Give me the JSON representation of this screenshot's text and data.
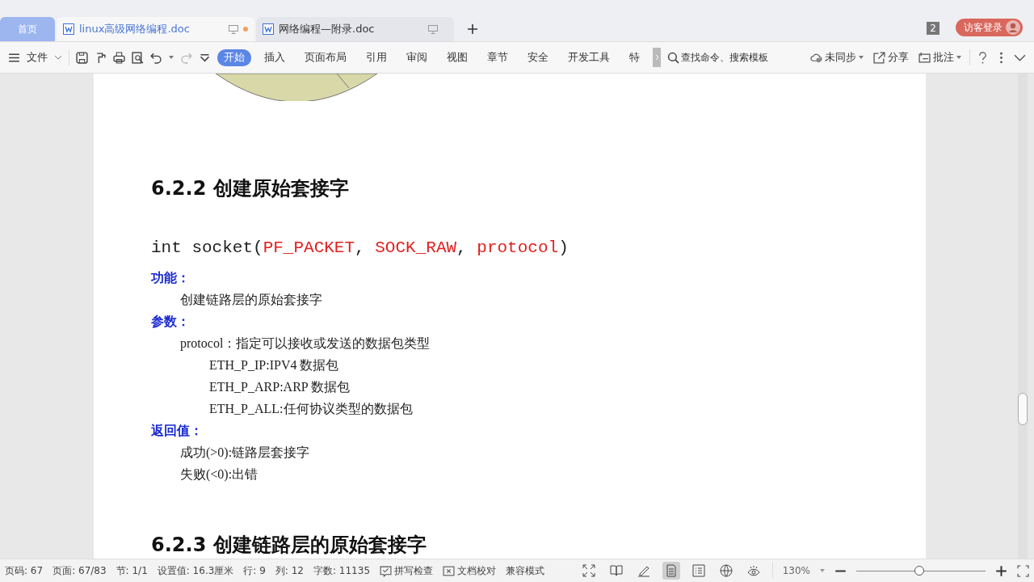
{
  "tabs": [
    {
      "label": "首页",
      "kind": "home",
      "selected": false
    },
    {
      "label": "linux高级网络编程.doc",
      "kind": "doc",
      "selected": true,
      "modified": true
    },
    {
      "label": "网络编程—附录.doc",
      "kind": "doc",
      "selected": false,
      "modified": false
    }
  ],
  "window_count": "2",
  "login_button": "访客登录",
  "file_menu": "文件",
  "ribbon_tabs": [
    {
      "label": "开始",
      "selected": true
    },
    {
      "label": "插入",
      "selected": false
    },
    {
      "label": "页面布局",
      "selected": false
    },
    {
      "label": "引用",
      "selected": false
    },
    {
      "label": "审阅",
      "selected": false
    },
    {
      "label": "视图",
      "selected": false
    },
    {
      "label": "章节",
      "selected": false
    },
    {
      "label": "安全",
      "selected": false
    },
    {
      "label": "开发工具",
      "selected": false
    },
    {
      "label": "特",
      "selected": false
    }
  ],
  "search": {
    "placeholder": "查找命令、搜索模板"
  },
  "actions": [
    {
      "label": "未同步",
      "kind": "cloud"
    },
    {
      "label": "分享",
      "kind": "share"
    },
    {
      "label": "批注",
      "kind": "comment"
    }
  ],
  "document": {
    "heading": "6.2.2 创建原始套接字",
    "code": [
      {
        "text": "int socket(",
        "kind": "plain"
      },
      {
        "text": "PF_PACKET",
        "kind": "arg"
      },
      {
        "text": ", ",
        "kind": "plain"
      },
      {
        "text": "SOCK_RAW",
        "kind": "arg"
      },
      {
        "text": ", ",
        "kind": "plain"
      },
      {
        "text": "protocol",
        "kind": "arg"
      },
      {
        "text": ")",
        "kind": "plain"
      }
    ],
    "sections": [
      {
        "label": "功能：",
        "lines": [
          {
            "text": "创建链路层的原始套接字"
          }
        ]
      },
      {
        "label": "参数：",
        "lines": [
          {
            "text": "protocol：指定可以接收或发送的数据包类型",
            "children": [
              {
                "text": "ETH_P_IP:IPV4 数据包"
              },
              {
                "text": "ETH_P_ARP:ARP 数据包"
              },
              {
                "text": "ETH_P_ALL:任何协议类型的数据包"
              }
            ]
          }
        ]
      },
      {
        "label": "返回值：",
        "lines": [
          {
            "text": "成功(>0):链路层套接字"
          },
          {
            "text": "失败(<0):出错"
          }
        ]
      }
    ],
    "next_heading": "6.2.3 创建链路层的原始套接字"
  },
  "status_bar": {
    "items": [
      "页码: 67",
      "页面: 67/83",
      "节: 1/1",
      "设置值: 16.3厘米",
      "行: 9",
      "列: 12",
      "字数: 11135"
    ],
    "tools": [
      {
        "label": "拼写检查",
        "kind": "spell"
      },
      {
        "label": "文档校对",
        "kind": "proof"
      }
    ],
    "mode": "兼容模式",
    "views": [
      {
        "kind": "fullscreen",
        "selected": false
      },
      {
        "kind": "read",
        "selected": false
      },
      {
        "kind": "pen",
        "selected": false
      },
      {
        "kind": "page",
        "selected": true
      },
      {
        "kind": "outline",
        "selected": false
      },
      {
        "kind": "web",
        "selected": false
      },
      {
        "kind": "eye",
        "selected": false
      }
    ],
    "zoom": "130%",
    "zoom_slider": {
      "level": 0.49
    }
  }
}
